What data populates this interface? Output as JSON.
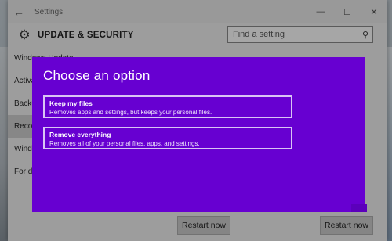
{
  "window": {
    "title": "Settings",
    "back_icon": "←",
    "controls": {
      "minimize": "—",
      "maximize": "☐",
      "close": "✕"
    }
  },
  "header": {
    "title": "UPDATE & SECURITY",
    "search_placeholder": "Find a setting"
  },
  "sidebar": {
    "items": [
      {
        "label": "Windows Update"
      },
      {
        "label": "Activation"
      },
      {
        "label": "Backup"
      },
      {
        "label": "Recovery",
        "selected": true
      },
      {
        "label": "Windows Defender"
      },
      {
        "label": "For developers"
      }
    ]
  },
  "main": {
    "restart_left_label": "Restart now",
    "restart_right_label": "Restart now"
  },
  "dialog": {
    "title": "Choose an option",
    "options": [
      {
        "title": "Keep my files",
        "description": "Removes apps and settings, but keeps your personal files."
      },
      {
        "title": "Remove everything",
        "description": "Removes all of your personal files, apps, and settings."
      }
    ]
  },
  "colors": {
    "dialog_bg": "#6700d1",
    "option_border": "#d9c4f4",
    "selected_sidebar_bg": "#cfcfcf"
  }
}
